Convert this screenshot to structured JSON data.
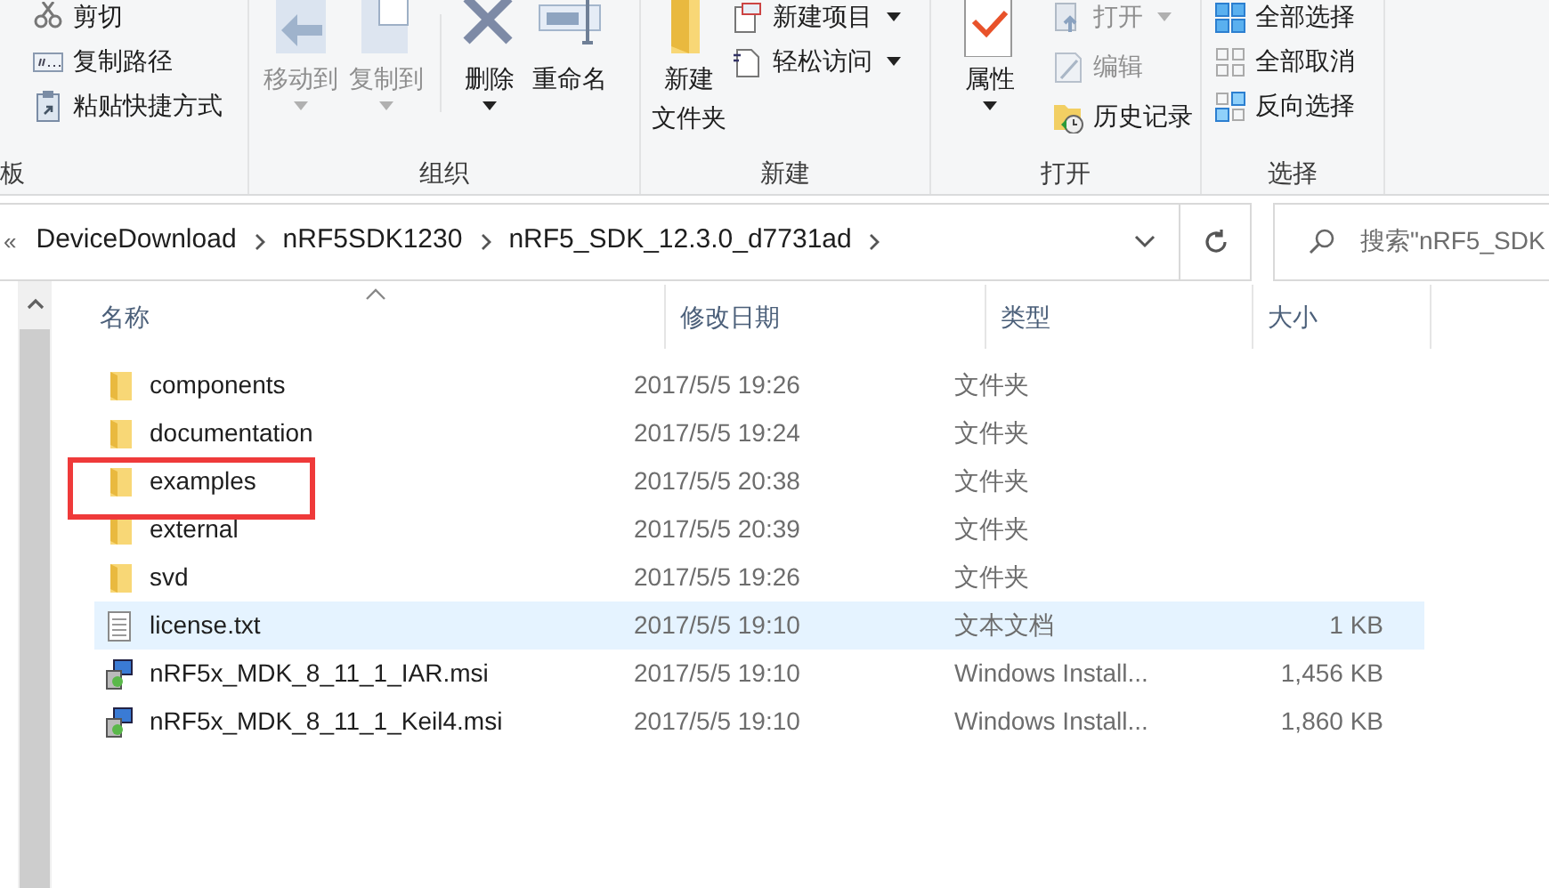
{
  "ribbon": {
    "groups": [
      {
        "label": "板",
        "columns": [
          {
            "kind": "small",
            "items": [
              {
                "label": "剪切",
                "disabled": false,
                "dropdown": false
              },
              {
                "label": "复制路径",
                "disabled": false,
                "dropdown": false
              },
              {
                "label": "粘贴快捷方式",
                "disabled": false,
                "dropdown": false
              }
            ]
          }
        ]
      },
      {
        "label": "组织",
        "columns": [
          {
            "kind": "large",
            "items": [
              {
                "label": "移动到",
                "disabled": true,
                "dropdown": true
              }
            ]
          },
          {
            "kind": "large",
            "items": [
              {
                "label": "复制到",
                "disabled": true,
                "dropdown": true
              }
            ]
          },
          {
            "kind": "divider"
          },
          {
            "kind": "large",
            "items": [
              {
                "label": "删除",
                "disabled": false,
                "dropdown": true
              }
            ]
          },
          {
            "kind": "large",
            "items": [
              {
                "label": "重命名",
                "disabled": false,
                "dropdown": false
              }
            ]
          }
        ]
      },
      {
        "label": "新建",
        "columns": [
          {
            "kind": "large",
            "items": [
              {
                "label_lines": [
                  "新建",
                  "文件夹"
                ],
                "disabled": false,
                "dropdown": false
              }
            ]
          },
          {
            "kind": "small",
            "items": [
              {
                "label": "新建项目",
                "disabled": false,
                "dropdown": true
              },
              {
                "label": "轻松访问",
                "disabled": false,
                "dropdown": true
              }
            ]
          }
        ]
      },
      {
        "label": "打开",
        "columns": [
          {
            "kind": "large",
            "items": [
              {
                "label": "属性",
                "disabled": false,
                "dropdown": true
              }
            ]
          },
          {
            "kind": "small",
            "items": [
              {
                "label": "打开",
                "disabled": true,
                "dropdown": true
              },
              {
                "label": "编辑",
                "disabled": true,
                "dropdown": false
              },
              {
                "label": "历史记录",
                "disabled": false,
                "dropdown": false
              }
            ]
          }
        ]
      },
      {
        "label": "选择",
        "columns": [
          {
            "kind": "small",
            "items": [
              {
                "label": "全部选择",
                "disabled": false,
                "dropdown": false
              },
              {
                "label": "全部取消",
                "disabled": false,
                "dropdown": false
              },
              {
                "label": "反向选择",
                "disabled": false,
                "dropdown": false
              }
            ]
          }
        ]
      }
    ]
  },
  "address_bar": {
    "overflow": "«",
    "crumbs": [
      "DeviceDownload",
      "nRF5SDK1230",
      "nRF5_SDK_12.3.0_d7731ad"
    ]
  },
  "search": {
    "placeholder": "搜索\"nRF5_SDK"
  },
  "file_list": {
    "columns": [
      "名称",
      "修改日期",
      "类型",
      "大小"
    ],
    "rows": [
      {
        "kind": "folder",
        "name": "components",
        "date": "2017/5/5 19:26",
        "type": "文件夹",
        "size": "",
        "hovered": false,
        "annotated": false
      },
      {
        "kind": "folder",
        "name": "documentation",
        "date": "2017/5/5 19:24",
        "type": "文件夹",
        "size": "",
        "hovered": false,
        "annotated": false
      },
      {
        "kind": "folder",
        "name": "examples",
        "date": "2017/5/5 20:38",
        "type": "文件夹",
        "size": "",
        "hovered": false,
        "annotated": true
      },
      {
        "kind": "folder",
        "name": "external",
        "date": "2017/5/5 20:39",
        "type": "文件夹",
        "size": "",
        "hovered": false,
        "annotated": false
      },
      {
        "kind": "folder",
        "name": "svd",
        "date": "2017/5/5 19:26",
        "type": "文件夹",
        "size": "",
        "hovered": false,
        "annotated": false
      },
      {
        "kind": "text",
        "name": "license.txt",
        "date": "2017/5/5 19:10",
        "type": "文本文档",
        "size": "1 KB",
        "hovered": true,
        "annotated": false
      },
      {
        "kind": "installer",
        "name": "nRF5x_MDK_8_11_1_IAR.msi",
        "date": "2017/5/5 19:10",
        "type": "Windows Install...",
        "size": "1,456 KB",
        "hovered": false,
        "annotated": false
      },
      {
        "kind": "installer",
        "name": "nRF5x_MDK_8_11_1_Keil4.msi",
        "date": "2017/5/5 19:10",
        "type": "Windows Install...",
        "size": "1,860 KB",
        "hovered": false,
        "annotated": false
      }
    ]
  }
}
